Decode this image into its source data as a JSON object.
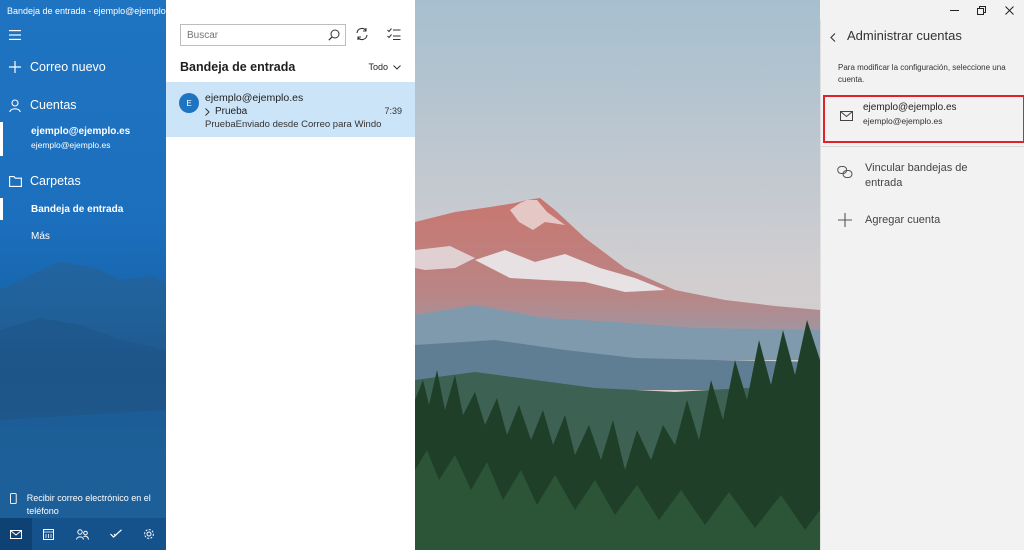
{
  "window": {
    "title": "Bandeja de entrada - ejemplo@ejemplo.es"
  },
  "nav": {
    "new_mail": "Correo nuevo",
    "accounts_label": "Cuentas",
    "account": {
      "name": "ejemplo@ejemplo.es",
      "email": "ejemplo@ejemplo.es"
    },
    "folders_label": "Carpetas",
    "folders": [
      "Bandeja de entrada",
      "Más"
    ],
    "phone_promo": "Recibir correo electrónico en el teléfono",
    "bottom_icons": [
      "mail-icon",
      "calendar-icon",
      "people-icon",
      "todo-icon",
      "settings-icon"
    ]
  },
  "list": {
    "search_placeholder": "Buscar",
    "heading": "Bandeja de entrada",
    "filter": "Todo",
    "messages": [
      {
        "avatar": "E",
        "sender": "ejemplo@ejemplo.es",
        "subject": "Prueba",
        "time": "7:39",
        "preview": "PruebaEnviado desde Correo para Windows"
      }
    ]
  },
  "flyout": {
    "title": "Administrar cuentas",
    "description": "Para modificar la configuración, seleccione una cuenta.",
    "account": {
      "name": "ejemplo@ejemplo.es",
      "email": "ejemplo@ejemplo.es"
    },
    "link_inboxes": "Vincular bandejas de entrada",
    "add_account": "Agregar cuenta"
  },
  "colors": {
    "accent": "#1f74c2",
    "selected_row": "#cce4f7",
    "highlight_border": "#e0202a"
  }
}
